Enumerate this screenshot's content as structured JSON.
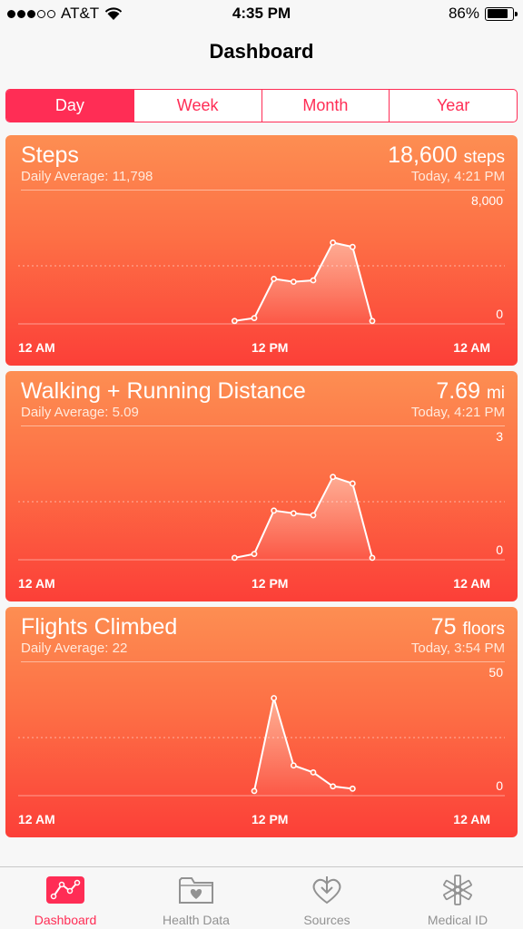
{
  "status_bar": {
    "carrier": "AT&T",
    "time": "4:35 PM",
    "battery": "86%"
  },
  "nav": {
    "title": "Dashboard"
  },
  "segments": [
    {
      "label": "Day",
      "active": true
    },
    {
      "label": "Week",
      "active": false
    },
    {
      "label": "Month",
      "active": false
    },
    {
      "label": "Year",
      "active": false
    }
  ],
  "cards": [
    {
      "title": "Steps",
      "average": "Daily Average: 11,798",
      "value": "18,600",
      "unit": "steps",
      "time": "Today, 4:21 PM",
      "ymax": "8,000",
      "ymin": "0",
      "xlabels": [
        "12 AM",
        "12 PM",
        "12 AM"
      ]
    },
    {
      "title": "Walking + Running Distance",
      "average": "Daily Average: 5.09",
      "value": "7.69",
      "unit": "mi",
      "time": "Today, 4:21 PM",
      "ymax": "3",
      "ymin": "0",
      "xlabels": [
        "12 AM",
        "12 PM",
        "12 AM"
      ]
    },
    {
      "title": "Flights Climbed",
      "average": "Daily Average: 22",
      "value": "75",
      "unit": "floors",
      "time": "Today, 3:54 PM",
      "ymax": "50",
      "ymin": "0",
      "xlabels": [
        "12 AM",
        "12 PM",
        "12 AM"
      ]
    }
  ],
  "chart_data": [
    {
      "type": "area",
      "title": "Steps",
      "x": [
        11,
        12,
        13,
        14,
        15,
        16,
        17,
        18
      ],
      "values": [
        200,
        400,
        3100,
        2900,
        3000,
        5600,
        5300,
        200
      ],
      "ylim": [
        0,
        8000
      ]
    },
    {
      "type": "area",
      "title": "Walking + Running Distance",
      "x": [
        11,
        12,
        13,
        14,
        15,
        16,
        17,
        18
      ],
      "values": [
        0.05,
        0.15,
        1.27,
        1.2,
        1.15,
        2.14,
        1.97,
        0.05
      ],
      "ylim": [
        0,
        3
      ]
    },
    {
      "type": "area",
      "title": "Flights Climbed",
      "x": [
        12,
        13,
        14,
        15,
        16,
        17
      ],
      "values": [
        2,
        42,
        13,
        10,
        4,
        3
      ],
      "ylim": [
        0,
        50
      ]
    }
  ],
  "tabs": [
    {
      "label": "Dashboard",
      "icon": "dashboard-chart-icon",
      "active": true
    },
    {
      "label": "Health Data",
      "icon": "health-data-folder-icon",
      "active": false
    },
    {
      "label": "Sources",
      "icon": "sources-heart-icon",
      "active": false
    },
    {
      "label": "Medical ID",
      "icon": "medical-id-star-icon",
      "active": false
    }
  ]
}
